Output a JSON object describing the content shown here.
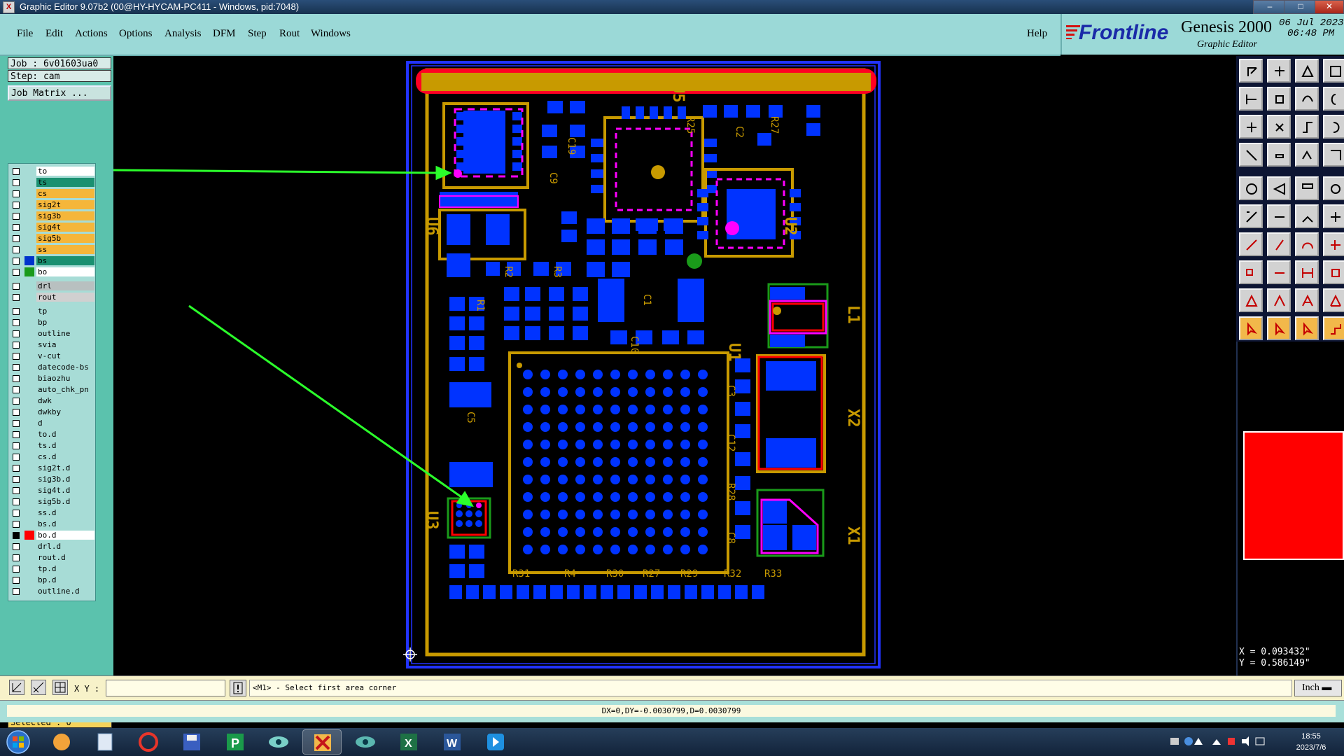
{
  "window": {
    "title": "Graphic Editor 9.07b2 (00@HY-HYCAM-PC411 - Windows, pid:7048)",
    "minimize": "–",
    "maximize": "□",
    "close": "✕"
  },
  "menu": {
    "items": [
      "File",
      "Edit",
      "Actions",
      "Options",
      "Analysis",
      "DFM",
      "Step",
      "Rout",
      "Windows"
    ],
    "help": "Help"
  },
  "branding": {
    "vendor": "Frontline",
    "product": "Genesis 2000",
    "subtitle": "Graphic Editor",
    "date": "06 Jul 2023",
    "time": "06:48 PM"
  },
  "job": {
    "job_label": "Job : 6v01603ua0",
    "step_label": "Step: cam",
    "matrix_button": "Job Matrix ..."
  },
  "layers": [
    {
      "name": "to",
      "color": "#ffffff",
      "bg": "#ffffff"
    },
    {
      "name": "ts",
      "color": "#1a9070",
      "bg": "#1a9070"
    },
    {
      "name": "cs",
      "color": "#f5b63a",
      "bg": "#f5b63a"
    },
    {
      "name": "sig2t",
      "color": "#f5b63a",
      "bg": "#f5b63a"
    },
    {
      "name": "sig3b",
      "color": "#f5b63a",
      "bg": "#f5b63a"
    },
    {
      "name": "sig4t",
      "color": "#f5b63a",
      "bg": "#f5b63a"
    },
    {
      "name": "sig5b",
      "color": "#f5b63a",
      "bg": "#f5b63a"
    },
    {
      "name": "ss",
      "color": "#f5b63a",
      "bg": "#f5b63a"
    },
    {
      "name": "bs",
      "color": "#1a9070",
      "bg": "#1a9070",
      "swatch": "#0033cc"
    },
    {
      "name": "bo",
      "color": "#ffffff",
      "bg": "#ffffff",
      "swatch": "#1a9a1a"
    },
    {
      "name": "drl",
      "color": "#b8c0c0",
      "bg": "#b8c0c0",
      "gap": true
    },
    {
      "name": "rout",
      "color": "#d0d0d0",
      "bg": "#d0d0d0"
    },
    {
      "name": "tp",
      "color": "#a7dcd6",
      "bg": "#a7dcd6",
      "gap": true
    },
    {
      "name": "bp",
      "color": "#a7dcd6",
      "bg": "#a7dcd6"
    },
    {
      "name": "outline",
      "color": "#a7dcd6",
      "bg": "#a7dcd6"
    },
    {
      "name": "svia",
      "color": "#a7dcd6",
      "bg": "#a7dcd6"
    },
    {
      "name": "v-cut",
      "color": "#a7dcd6",
      "bg": "#a7dcd6"
    },
    {
      "name": "datecode-bs",
      "color": "#a7dcd6",
      "bg": "#a7dcd6"
    },
    {
      "name": "biaozhu",
      "color": "#a7dcd6",
      "bg": "#a7dcd6"
    },
    {
      "name": "auto_chk_pn",
      "color": "#a7dcd6",
      "bg": "#a7dcd6"
    },
    {
      "name": "dwk",
      "color": "#a7dcd6",
      "bg": "#a7dcd6"
    },
    {
      "name": "dwkby",
      "color": "#a7dcd6",
      "bg": "#a7dcd6"
    },
    {
      "name": "d",
      "color": "#a7dcd6",
      "bg": "#a7dcd6"
    },
    {
      "name": "to.d",
      "color": "#a7dcd6",
      "bg": "#a7dcd6"
    },
    {
      "name": "ts.d",
      "color": "#a7dcd6",
      "bg": "#a7dcd6"
    },
    {
      "name": "cs.d",
      "color": "#a7dcd6",
      "bg": "#a7dcd6"
    },
    {
      "name": "sig2t.d",
      "color": "#a7dcd6",
      "bg": "#a7dcd6"
    },
    {
      "name": "sig3b.d",
      "color": "#a7dcd6",
      "bg": "#a7dcd6"
    },
    {
      "name": "sig4t.d",
      "color": "#a7dcd6",
      "bg": "#a7dcd6"
    },
    {
      "name": "sig5b.d",
      "color": "#a7dcd6",
      "bg": "#a7dcd6"
    },
    {
      "name": "ss.d",
      "color": "#a7dcd6",
      "bg": "#a7dcd6"
    },
    {
      "name": "bs.d",
      "color": "#a7dcd6",
      "bg": "#a7dcd6"
    },
    {
      "name": "bo.d",
      "color": "#ffffff",
      "bg": "#ffffff",
      "swatch": "#ff0000",
      "checked": true
    },
    {
      "name": "drl.d",
      "color": "#a7dcd6",
      "bg": "#a7dcd6"
    },
    {
      "name": "rout.d",
      "color": "#a7dcd6",
      "bg": "#a7dcd6"
    },
    {
      "name": "tp.d",
      "color": "#a7dcd6",
      "bg": "#a7dcd6"
    },
    {
      "name": "bp.d",
      "color": "#a7dcd6",
      "bg": "#a7dcd6"
    },
    {
      "name": "outline.d",
      "color": "#a7dcd6",
      "bg": "#a7dcd6"
    }
  ],
  "selected_label": "Selected : 0",
  "board_labels": [
    "U5",
    "U6",
    "U2",
    "U3",
    "U1",
    "X2",
    "X1",
    "C5",
    "C9",
    "C1",
    "C19",
    "R1",
    "R2",
    "R3",
    "R4",
    "R30",
    "R27",
    "R29",
    "R32",
    "R33",
    "R31",
    "R28",
    "C3",
    "C12",
    "C8",
    "R27",
    "R25",
    "L1",
    "C2",
    "C10"
  ],
  "pointer_readout": {
    "x": "X = 0.093432\"",
    "y": "Y = 0.586149\""
  },
  "command": {
    "xy_label": "X Y :",
    "xy_value": "",
    "prompt": "<M1> - Select first area corner",
    "units": "Inch"
  },
  "status": "DX=0,DY=-0.0030799,D=0.0030799",
  "taskbar": {
    "time": "18:55",
    "date": "2023/7/6"
  },
  "colors": {
    "pad": "#0033ff",
    "silk": "#c89a00",
    "mask": "#ff00ff",
    "board_outline": "#2233ff",
    "highlight": "#ff0000",
    "annotation_arrow": "#2bff2b"
  }
}
